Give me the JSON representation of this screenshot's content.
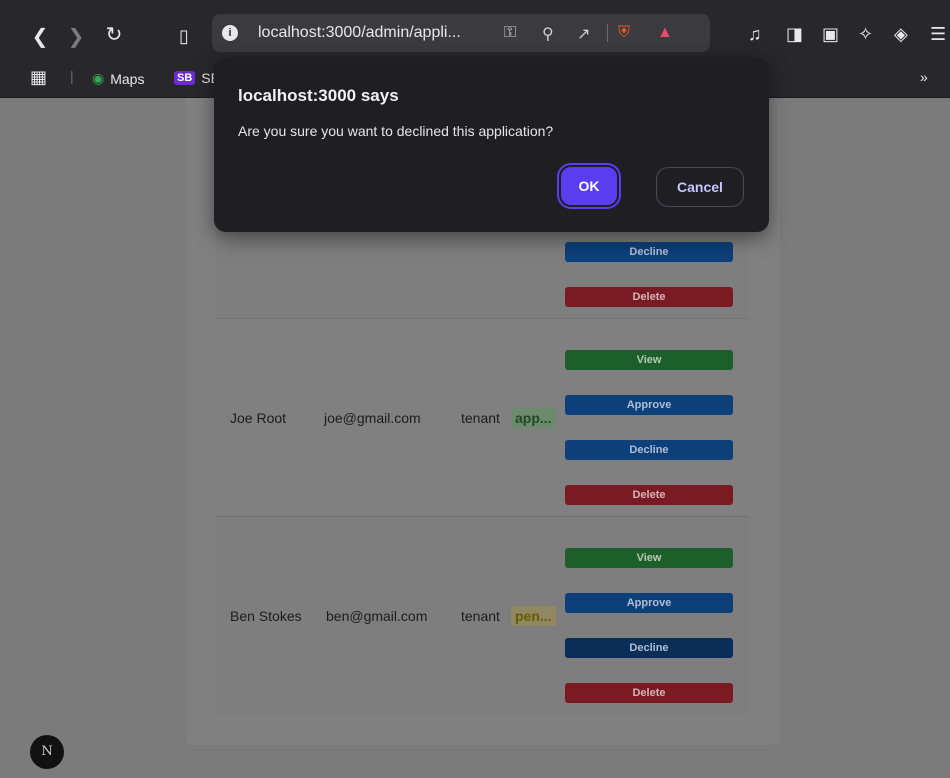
{
  "browser": {
    "url": "localhost:3000/admin/appli...",
    "bookmarks": [
      {
        "label": "Maps"
      },
      {
        "badge": "SB",
        "label": "SE"
      }
    ]
  },
  "dialog": {
    "title": "localhost:3000 says",
    "message": "Are you sure you want to declined this application?",
    "ok_label": "OK",
    "cancel_label": "Cancel"
  },
  "actions": {
    "view": "View",
    "approve": "Approve",
    "decline": "Decline",
    "delete": "Delete"
  },
  "applications": [
    {
      "name": "Joe Root",
      "email": "joe@gmail.com",
      "role": "tenant",
      "status": "app..."
    },
    {
      "name": "Ben Stokes",
      "email": "ben@gmail.com",
      "role": "tenant",
      "status": "pen..."
    }
  ],
  "next_badge": "N"
}
